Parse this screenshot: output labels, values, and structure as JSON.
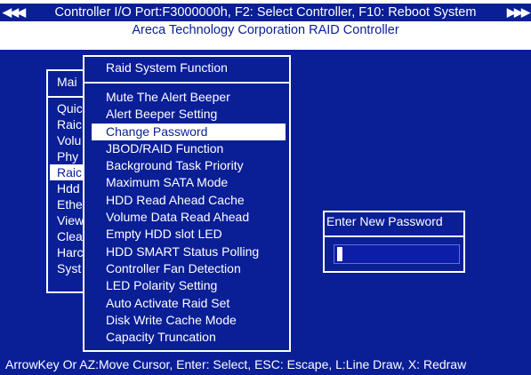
{
  "header": {
    "arrows_left": "◀◀◀",
    "arrows_right": "▶▶▶",
    "status_line": "Controller I/O Port:F3000000h, F2: Select Controller, F10: Reboot System",
    "subtitle": "Areca Technology Corporation RAID Controller"
  },
  "main_menu": {
    "title": "Mai",
    "items": [
      "Quic",
      "Raic",
      "Volu",
      "Phy",
      "Raic",
      "Hdd",
      "Ethe",
      "View",
      "Clea",
      "Harc",
      "Syst"
    ],
    "selected_index": 4
  },
  "raid_function_menu": {
    "title": "Raid System Function",
    "items": [
      "Mute The Alert Beeper",
      "Alert Beeper Setting",
      "Change Password",
      "JBOD/RAID Function",
      "Background Task Priority",
      "Maximum SATA Mode",
      "HDD Read Ahead Cache",
      "Volume Data Read Ahead",
      "Empty HDD slot LED",
      "HDD SMART Status Polling",
      "Controller Fan Detection",
      "LED Polarity Setting",
      "Auto Activate Raid Set",
      "Disk Write Cache Mode",
      "Capacity Truncation"
    ],
    "selected_index": 2
  },
  "password_dialog": {
    "title": "Enter New Password",
    "value": ""
  },
  "footer": {
    "help": "ArrowKey Or AZ:Move Cursor, Enter: Select, ESC: Escape, L:Line Draw, X: Redraw"
  },
  "colors": {
    "background_blue": "#0a1e96",
    "text": "#ffffff",
    "highlight": "#ffffff"
  }
}
